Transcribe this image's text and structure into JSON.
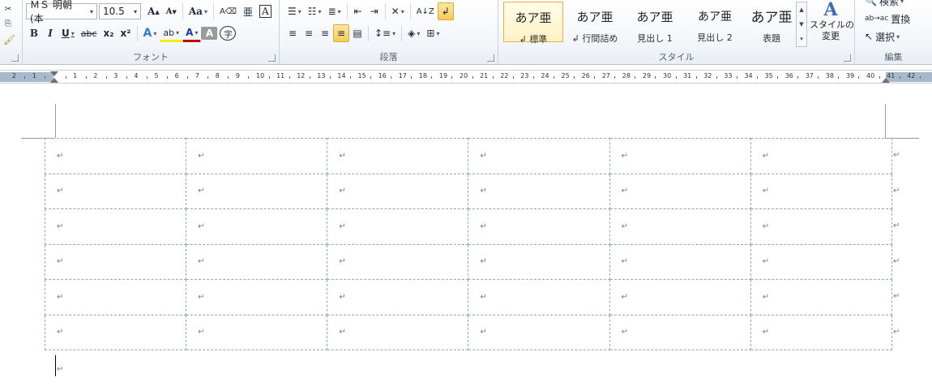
{
  "font_group": {
    "label": "フォント",
    "font_name": "ＭＳ 明朝 (本",
    "font_size": "10.5",
    "grow_icon": "A",
    "shrink_icon": "A",
    "case_label": "Aa",
    "ruby_label": "亜",
    "bold": "B",
    "italic": "I",
    "underline": "U",
    "strike": "abc",
    "subscript": "x₂",
    "superscript": "x²",
    "text_effect": "A",
    "highlight": "ab",
    "font_color": "A",
    "char_shade": "A",
    "enclose": "字"
  },
  "paragraph_group": {
    "label": "段落"
  },
  "styles_group": {
    "label": "スタイル",
    "items": [
      {
        "sample": "あア亜",
        "name": "↲ 標準"
      },
      {
        "sample": "あア亜",
        "name": "↲ 行間詰め"
      },
      {
        "sample": "あア亜",
        "name": "見出し 1"
      },
      {
        "sample": "あア亜",
        "name": "見出し 2"
      },
      {
        "sample": "あア亜",
        "name": "表題"
      }
    ],
    "change_styles": "スタイルの\n変更"
  },
  "editing_group": {
    "label": "編集",
    "find": "検索",
    "replace": "置換",
    "select": "選択"
  },
  "ruler": {
    "left_numbers": [
      "2",
      "1"
    ],
    "numbers": [
      "1",
      "2",
      "3",
      "4",
      "5",
      "6",
      "7",
      "8",
      "9",
      "10",
      "11",
      "12",
      "13",
      "14",
      "15",
      "16",
      "17",
      "18",
      "19",
      "20",
      "21",
      "22",
      "23",
      "24",
      "25",
      "26",
      "27",
      "28",
      "29",
      "30",
      "31",
      "32",
      "33",
      "34",
      "35",
      "36",
      "37",
      "38",
      "39",
      "40",
      "41",
      "42"
    ]
  },
  "table": {
    "rows": 6,
    "cols": 6,
    "cell_mark": "↵",
    "row_end_mark": "↵"
  },
  "colors": {
    "selected_style_border": "#e3b143",
    "active_button": "#f8cc55",
    "table_border": "#8fa8c8"
  }
}
